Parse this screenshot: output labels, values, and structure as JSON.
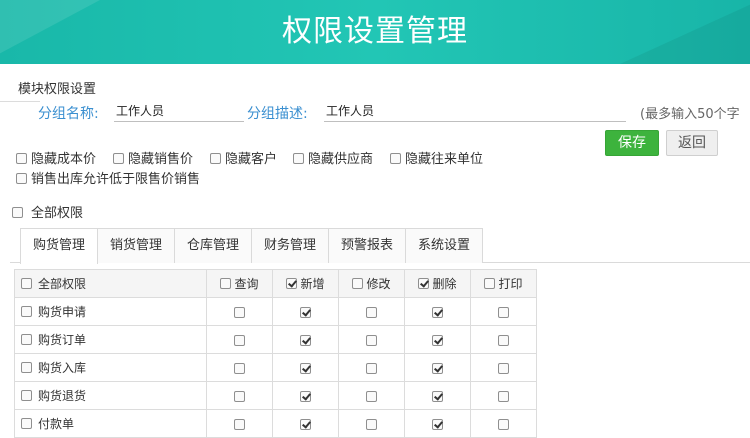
{
  "header": {
    "title": "权限设置管理"
  },
  "section_title": "模块权限设置",
  "group": {
    "name_label": "分组名称:",
    "name_value": "工作人员",
    "desc_label": "分组描述:",
    "desc_value": "工作人员",
    "hint": "(最多输入50个字"
  },
  "buttons": {
    "save": "保存",
    "back": "返回"
  },
  "options": {
    "hide_cost": "隐藏成本价",
    "hide_sale_price": "隐藏销售价",
    "hide_customer": "隐藏客户",
    "hide_supplier": "隐藏供应商",
    "hide_partner": "隐藏往来单位",
    "allow_low_price": "销售出库允许低于限售价销售",
    "all_permissions": "全部权限"
  },
  "tabs": [
    "购货管理",
    "销货管理",
    "仓库管理",
    "财务管理",
    "预警报表",
    "系统设置"
  ],
  "active_tab": "购货管理",
  "table": {
    "header": {
      "all": "全部权限",
      "cols": [
        "查询",
        "新增",
        "修改",
        "删除",
        "打印"
      ],
      "checked": [
        false,
        true,
        false,
        true,
        false
      ]
    },
    "rows": [
      {
        "name": "购货申请",
        "checked": [
          false,
          true,
          false,
          true,
          false
        ]
      },
      {
        "name": "购货订单",
        "checked": [
          false,
          true,
          false,
          true,
          false
        ]
      },
      {
        "name": "购货入库",
        "checked": [
          false,
          true,
          false,
          true,
          false
        ]
      },
      {
        "name": "购货退货",
        "checked": [
          false,
          true,
          false,
          true,
          false
        ]
      },
      {
        "name": "付款单",
        "checked": [
          false,
          true,
          false,
          true,
          false
        ]
      }
    ]
  }
}
